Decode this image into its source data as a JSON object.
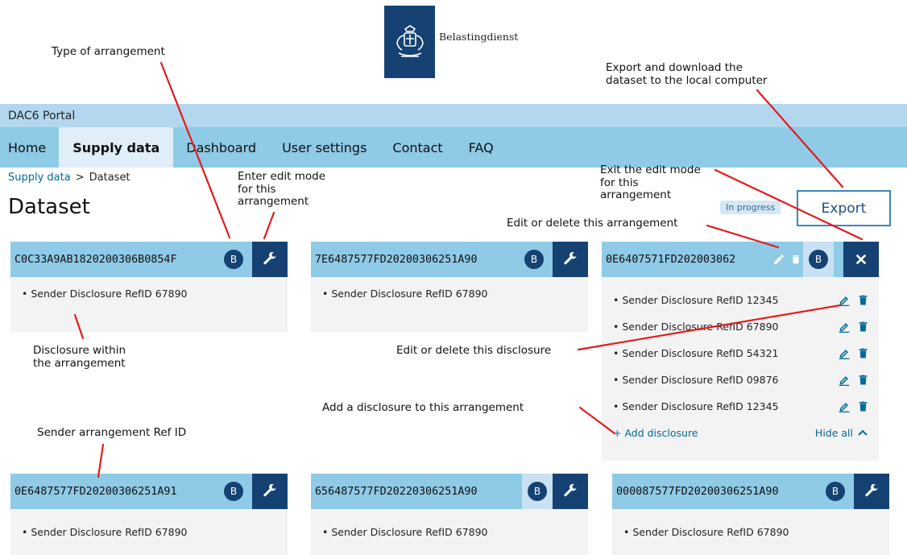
{
  "logo": {
    "brand": "Belastingdienst"
  },
  "portal": {
    "title": "DAC6 Portal"
  },
  "nav": [
    {
      "label": "Home"
    },
    {
      "label": "Supply data"
    },
    {
      "label": "Dashboard"
    },
    {
      "label": "User settings"
    },
    {
      "label": "Contact"
    },
    {
      "label": "FAQ"
    }
  ],
  "breadcrumb": {
    "parent": "Supply data",
    "separator": ">",
    "current": "Dataset"
  },
  "page": {
    "title": "Dataset",
    "status": "In progress",
    "export_label": "Export"
  },
  "cards": [
    {
      "id": "C0C33A9AB1820200306B0854F",
      "badge": "B",
      "items": [
        "Sender Disclosure RefID 67890"
      ]
    },
    {
      "id": "7E6487577FD20200306251A90",
      "badge": "B",
      "items": [
        "Sender Disclosure RefID 67890"
      ]
    },
    {
      "id": "0E6407571FD202003062",
      "badge": "B",
      "items": [
        "Sender Disclosure RefID 12345",
        "Sender Disclosure RefID 67890",
        "Sender Disclosure RefID 54321",
        "Sender Disclosure RefID 09876",
        "Sender Disclosure RefID 12345"
      ],
      "add_label": "+ Add disclosure",
      "hide_label": "Hide all"
    },
    {
      "id": "0E6487577FD20200306251A91",
      "badge": "B",
      "items": [
        "Sender Disclosure RefID 67890"
      ]
    },
    {
      "id": "656487577FD20220306251A90",
      "badge": "B",
      "items": [
        "Sender Disclosure RefID 67890"
      ]
    },
    {
      "id": "000087577FD20200306251A90",
      "badge": "B",
      "items": [
        "Sender Disclosure RefID 67890"
      ]
    }
  ],
  "annotations": {
    "type_of_arrangement": "Type of arrangement",
    "export_download": [
      "Export and download the",
      "dataset to the local computer"
    ],
    "enter_edit": [
      "Enter edit mode",
      "for this",
      "arrangement"
    ],
    "exit_edit": [
      "Exit the edit mode",
      "for this",
      "arrangement"
    ],
    "edit_delete_arrangement": "Edit or delete this arrangement",
    "disclosure_within": [
      "Disclosure within",
      "the arrangement"
    ],
    "edit_delete_disclosure": "Edit or delete this disclosure",
    "add_disclosure": "Add a disclosure to this arrangement",
    "sender_ref": "Sender arrangement Ref ID"
  },
  "colors": {
    "annotation_line": "#e21c1c",
    "nav_blue": "#8fcae7",
    "dark_blue": "#154273",
    "link_blue": "#01689b"
  }
}
